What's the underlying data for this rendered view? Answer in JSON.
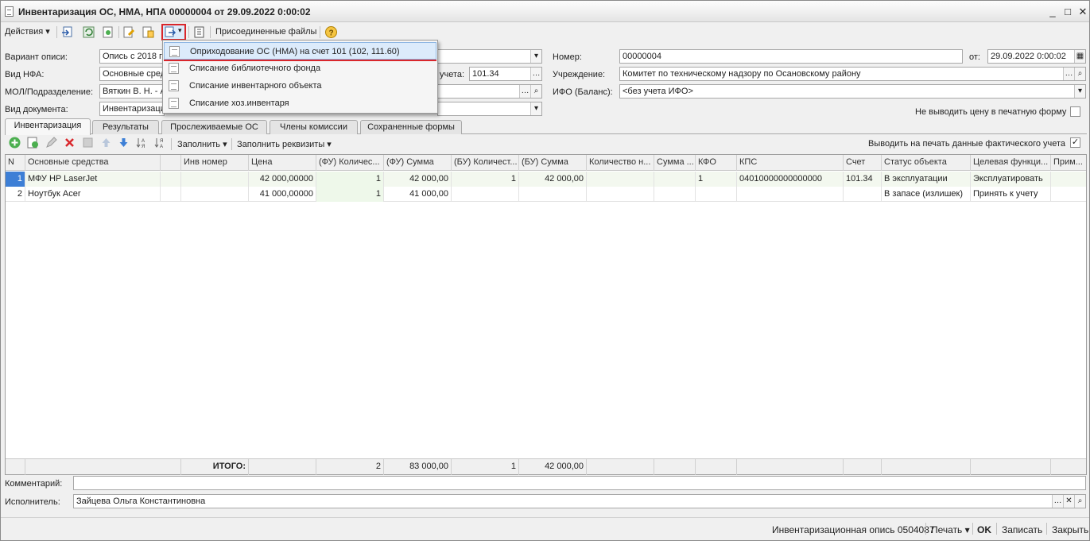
{
  "window": {
    "title": "Инвентаризация ОС, НМА, НПА 00000004 от 29.09.2022 0:00:02",
    "minimize": "_",
    "maximize": "□",
    "close": "✕"
  },
  "toolbar": {
    "actions": "Действия",
    "attached_files": "Присоединенные файлы"
  },
  "menu": {
    "items": [
      "Оприходование ОС (НМА) на счет 101 (102, 111.60)",
      "Списание библиотечного фонда",
      "Списание инвентарного объекта",
      "Списание хоз.инвентаря"
    ]
  },
  "form": {
    "variant_label": "Вариант описи:",
    "variant_value": "Опись с 2018 г",
    "nfa_label": "Вид НФА:",
    "nfa_value": "Основные сред",
    "account_label": "учета:",
    "account_value": "101.34",
    "mol_label": "МОЛ/Подразделение:",
    "mol_value": "Вяткин В. Н. - А",
    "doctype_label": "Вид документа:",
    "doctype_value": "Инвентаризаци",
    "number_label": "Номер:",
    "number_value": "00000004",
    "date_label": "от:",
    "date_value": "29.09.2022  0:00:02",
    "org_label": "Учреждение:",
    "org_value": "Комитет по техническому надзору по Осановскому району",
    "ifo_label": "ИФО (Баланс):",
    "ifo_value": "<без учета ИФО>",
    "no_price_label": "Не выводить цену в печатную форму"
  },
  "tabs": [
    "Инвентаризация",
    "Результаты",
    "Прослеживаемые ОС",
    "Члены комиссии",
    "Сохраненные формы"
  ],
  "table_toolbar": {
    "fill": "Заполнить",
    "fill_req": "Заполнить реквизиты",
    "print_actual": "Выводить на печать данные фактического учета"
  },
  "table": {
    "headers": [
      "N",
      "Основные средства",
      "",
      "Инв номер",
      "Цена",
      "(ФУ) Количес...",
      "(ФУ) Сумма",
      "(БУ) Количест...",
      "(БУ) Сумма",
      "Количество н...",
      "Сумма ...",
      "КФО",
      "КПС",
      "Счет",
      "Статус объекта",
      "Целевая функци...",
      "Прим..."
    ],
    "rows": [
      [
        "1",
        "МФУ HP LaserJet",
        "",
        "",
        "42 000,00000",
        "1",
        "42 000,00",
        "1",
        "42 000,00",
        "",
        "",
        "1",
        "04010000000000000",
        "101.34",
        "В эксплуатации",
        "Эксплуатировать",
        ""
      ],
      [
        "2",
        "Ноутбук Acer",
        "",
        "",
        "41 000,00000",
        "1",
        "41 000,00",
        "",
        "",
        "",
        "",
        "",
        "",
        "",
        "В запасе (излишек)",
        "Принять к учету",
        ""
      ]
    ],
    "footer": {
      "total_label": "ИТОГО:",
      "fu_qty": "2",
      "fu_sum": "83 000,00",
      "bu_qty": "1",
      "bu_sum": "42 000,00"
    }
  },
  "comment_label": "Комментарий:",
  "executor_label": "Исполнитель:",
  "executor_value": "Зайцева Ольга Константиновна",
  "statusbar": {
    "inv": "Инвентаризационная опись 0504087",
    "print": "Печать",
    "ok": "OK",
    "save": "Записать",
    "close": "Закрыть"
  }
}
